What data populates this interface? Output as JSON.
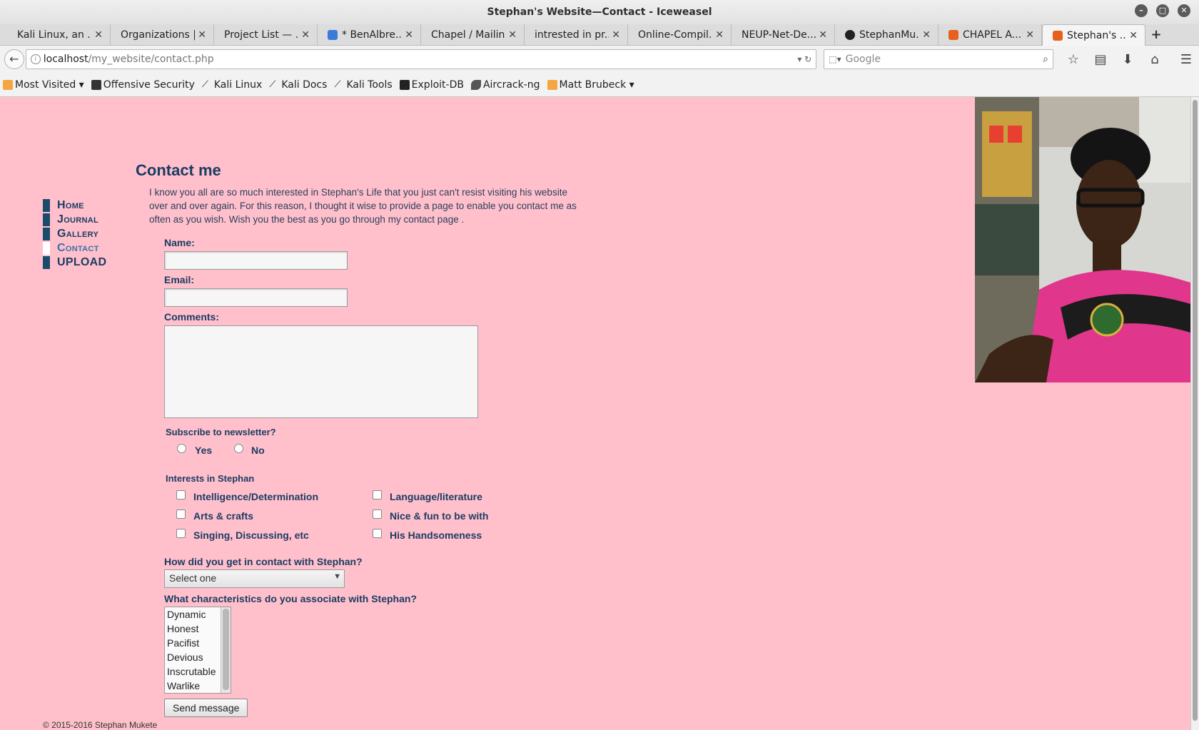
{
  "window": {
    "title": "Stephan's Website—Contact - Iceweasel"
  },
  "tabs": [
    {
      "label": "Kali Linux, an ...",
      "icon": "none"
    },
    {
      "label": "Organizations |...",
      "icon": "none"
    },
    {
      "label": "Project List — ...",
      "icon": "none"
    },
    {
      "label": "* BenAlbre...",
      "icon": "blue-app-icon"
    },
    {
      "label": "Chapel / Mailin...",
      "icon": "none"
    },
    {
      "label": "intrested in pr...",
      "icon": "none"
    },
    {
      "label": "Online-Compil...",
      "icon": "none"
    },
    {
      "label": "NEUP-Net-De...",
      "icon": "none"
    },
    {
      "label": "StephanMu...",
      "icon": "github-icon"
    },
    {
      "label": "CHAPEL A...",
      "icon": "orange-icon"
    },
    {
      "label": "Stephan's ...",
      "icon": "orange-icon",
      "active": true
    }
  ],
  "nav": {
    "url_host": "localhost",
    "url_path": "/my_website/contact.php",
    "search_placeholder": "Google"
  },
  "bookmarks": [
    {
      "label": "Most Visited ▾",
      "icon": "rss-folder-icon"
    },
    {
      "label": "Offensive Security",
      "icon": "offsec-icon"
    },
    {
      "label": "Kali Linux",
      "icon": "kali-dragon-icon"
    },
    {
      "label": "Kali Docs",
      "icon": "kali-dragon-icon"
    },
    {
      "label": "Kali Tools",
      "icon": "kali-dragon-icon"
    },
    {
      "label": "Exploit-DB",
      "icon": "exploitdb-icon"
    },
    {
      "label": "Aircrack-ng",
      "icon": "aircrack-icon"
    },
    {
      "label": "Matt Brubeck ▾",
      "icon": "rss-icon"
    }
  ],
  "site_nav": {
    "items": [
      {
        "label": "Home",
        "active": false
      },
      {
        "label": "Journal",
        "active": false
      },
      {
        "label": "Gallery",
        "active": false
      },
      {
        "label": "Contact",
        "active": true
      },
      {
        "label": "UPLOAD",
        "active": false
      }
    ]
  },
  "content": {
    "heading": "Contact me",
    "intro": "I know you all are so much interested in Stephan's Life that you just can't resist visiting his website over and over again. For this reason, I thought it wise to provide a page to enable you contact me as often as you wish. Wish you the best as you go through my contact page ."
  },
  "form": {
    "name_label": "Name:",
    "email_label": "Email:",
    "comments_label": "Comments:",
    "subscribe_label": "Subscribe to newsletter?",
    "yes_label": "Yes",
    "no_label": "No",
    "interests_label": "Interests in Stephan",
    "interests": [
      "Intelligence/Determination",
      "Language/literature",
      "Arts & crafts",
      "Nice & fun to be with",
      "Singing, Discussing, etc",
      "His Handsomeness"
    ],
    "contact_question": "How did you get in contact with Stephan?",
    "contact_select": "Select one",
    "characteristics_question": "What characteristics do you associate with Stephan?",
    "characteristics": [
      "Dynamic",
      "Honest",
      "Pacifist",
      "Devious",
      "Inscrutable",
      "Warlike"
    ],
    "send_label": "Send message"
  },
  "footer": {
    "text": "© 2015-2016 Stephan Mukete"
  },
  "colors": {
    "page_bg": "#ffc0cb",
    "nav_text": "#1b3c64",
    "active_nav": "#3a72a8"
  }
}
